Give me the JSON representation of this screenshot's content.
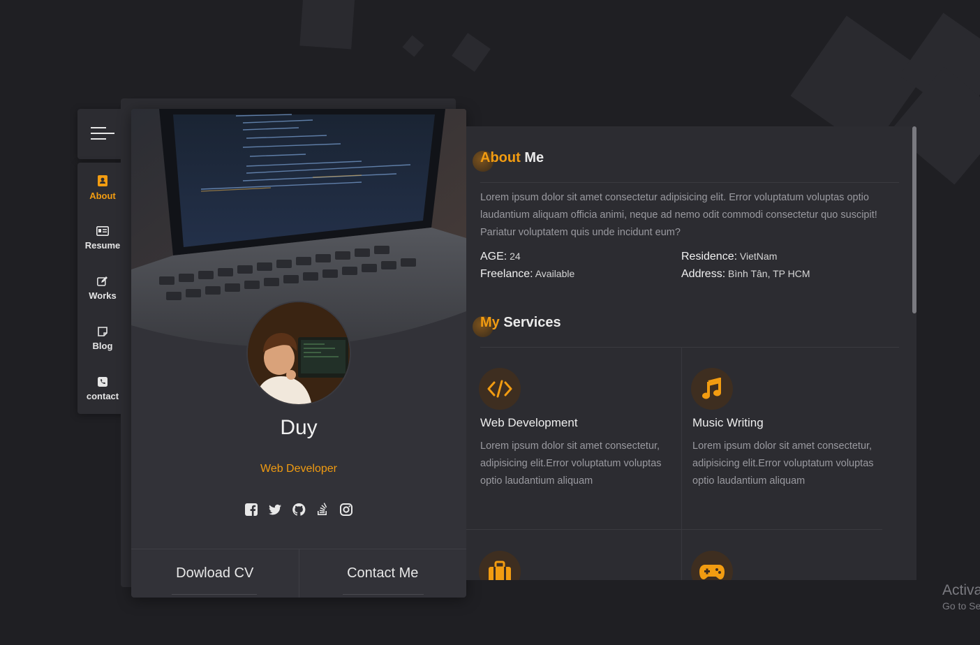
{
  "nav": {
    "menu_icon": "hamburger-icon",
    "items": [
      {
        "label": "About",
        "icon": "contact-book-icon",
        "active": true
      },
      {
        "label": "Resume",
        "icon": "id-card-icon",
        "active": false
      },
      {
        "label": "Works",
        "icon": "edit-icon",
        "active": false
      },
      {
        "label": "Blog",
        "icon": "note-icon",
        "active": false
      },
      {
        "label": "contact",
        "icon": "phone-icon",
        "active": false
      }
    ]
  },
  "profile": {
    "name": "Duy",
    "role": "Web Developer",
    "socials": [
      "facebook-icon",
      "twitter-icon",
      "github-icon",
      "stackoverflow-icon",
      "instagram-icon"
    ],
    "download_label": "Dowload CV",
    "contact_label": "Contact Me"
  },
  "about": {
    "title_accent": "About",
    "title_rest": " Me",
    "text": "Lorem ipsum dolor sit amet consectetur adipisicing elit. Error voluptatum voluptas optio laudantium aliquam officia animi, neque ad nemo odit commodi consectetur quo suscipit! Pariatur voluptatem quis unde incidunt eum?",
    "age_label": "AGE:",
    "age_value": " 24",
    "freelance_label": "Freelance:",
    "freelance_value": " Available",
    "residence_label": "Residence:",
    "residence_value": " VietNam",
    "address_label": "Address:",
    "address_value": " Bình Tân, TP HCM"
  },
  "services": {
    "title_accent": "My",
    "title_rest": " Services",
    "items": [
      {
        "title": "Web Development",
        "icon": "code-icon",
        "text": "Lorem ipsum dolor sit amet consectetur, adipisicing elit.Error voluptatum voluptas optio laudantium aliquam"
      },
      {
        "title": "Music Writing",
        "icon": "music-icon",
        "text": "Lorem ipsum dolor sit amet consectetur, adipisicing elit.Error voluptatum voluptas optio laudantium aliquam"
      },
      {
        "title": "",
        "icon": "briefcase-icon",
        "text": ""
      },
      {
        "title": "",
        "icon": "gamepad-icon",
        "text": ""
      }
    ]
  },
  "os_watermark": {
    "line1": "Activa",
    "line2": "Go to Se"
  },
  "colors": {
    "accent": "#f29c11",
    "background": "#1f1f23",
    "panel": "#2c2c31"
  }
}
